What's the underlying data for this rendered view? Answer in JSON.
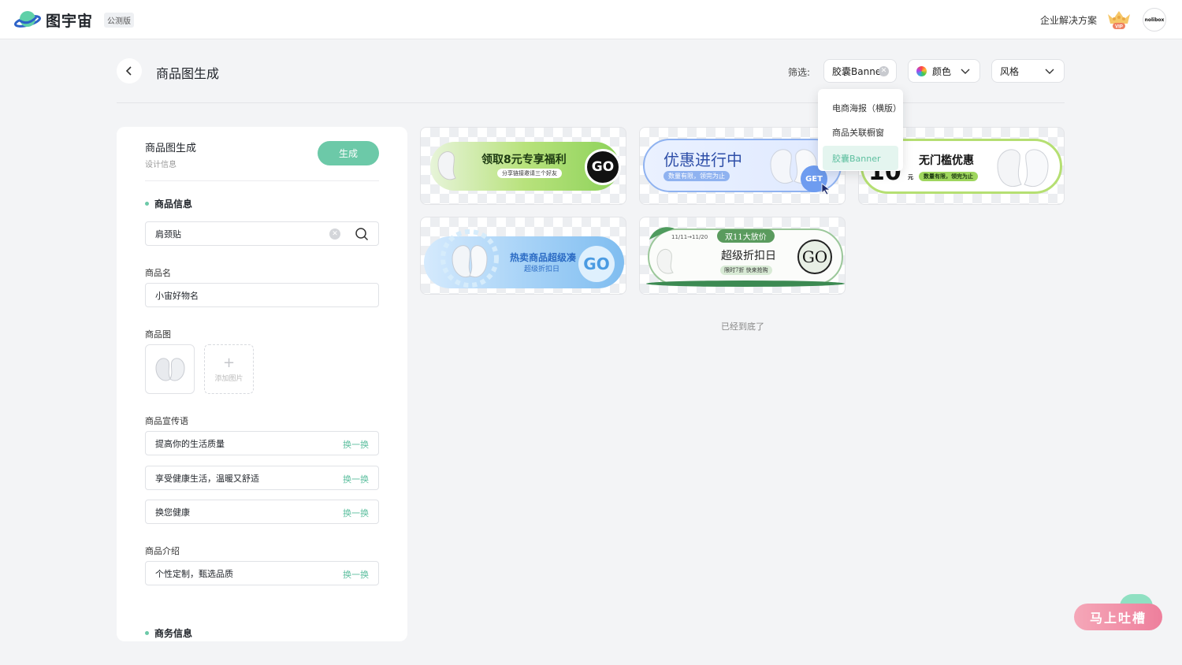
{
  "topbar": {
    "app_name": "图宇宙",
    "beta_label": "公测版",
    "enterprise_link": "企业解决方案",
    "vip_label": "VIP",
    "avatar_text": "nolibox"
  },
  "header": {
    "title": "商品图生成",
    "filter_label": "筛选:",
    "filter_type": "胶囊Banner",
    "filter_color": "颜色",
    "filter_style": "风格"
  },
  "dropdown": {
    "items": [
      "电商海报（横版）",
      "商品关联橱窗",
      "胶囊Banner"
    ]
  },
  "panel": {
    "title": "商品图生成",
    "subtitle": "设计信息",
    "generate_label": "生成",
    "section_product": "商品信息",
    "search_value": "肩颈贴",
    "name_label": "商品名",
    "name_value": "小宙好物名",
    "image_label": "商品图",
    "add_image_label": "添加图片",
    "slogan_label": "商品宣传语",
    "slogans": [
      "提高你的生活质量",
      "享受健康生活，温暖又舒适",
      "换您健康"
    ],
    "swap_label": "换一换",
    "intro_label": "商品介绍",
    "intro_value": "个性定制，甄选品质",
    "section_business": "商务信息"
  },
  "banners": [
    {
      "title": "领取8元专享福利",
      "sub": "分享链接邀请三个好友",
      "cta": "GO"
    },
    {
      "title": "优惠进行中",
      "sub": "数量有限，领完为止",
      "cta": "GET"
    },
    {
      "title": "无门槛优惠",
      "num": "10",
      "unit": "元",
      "sub": "数量有限，领完为止"
    },
    {
      "title": "热卖商品超级凑",
      "sub": "超级折扣日",
      "cta": "GO"
    },
    {
      "date": "11/11→11/20",
      "tag": "双11大放价",
      "title": "超级折扣日",
      "sub": "限时7折 快来抢购",
      "cta": "GO"
    }
  ],
  "end_text": "已经到底了",
  "feedback_label": "马上吐槽",
  "colors": {
    "accent": "#6cc9a8",
    "accent_text": "#5dbf9f",
    "background": "#f3f4f6"
  }
}
